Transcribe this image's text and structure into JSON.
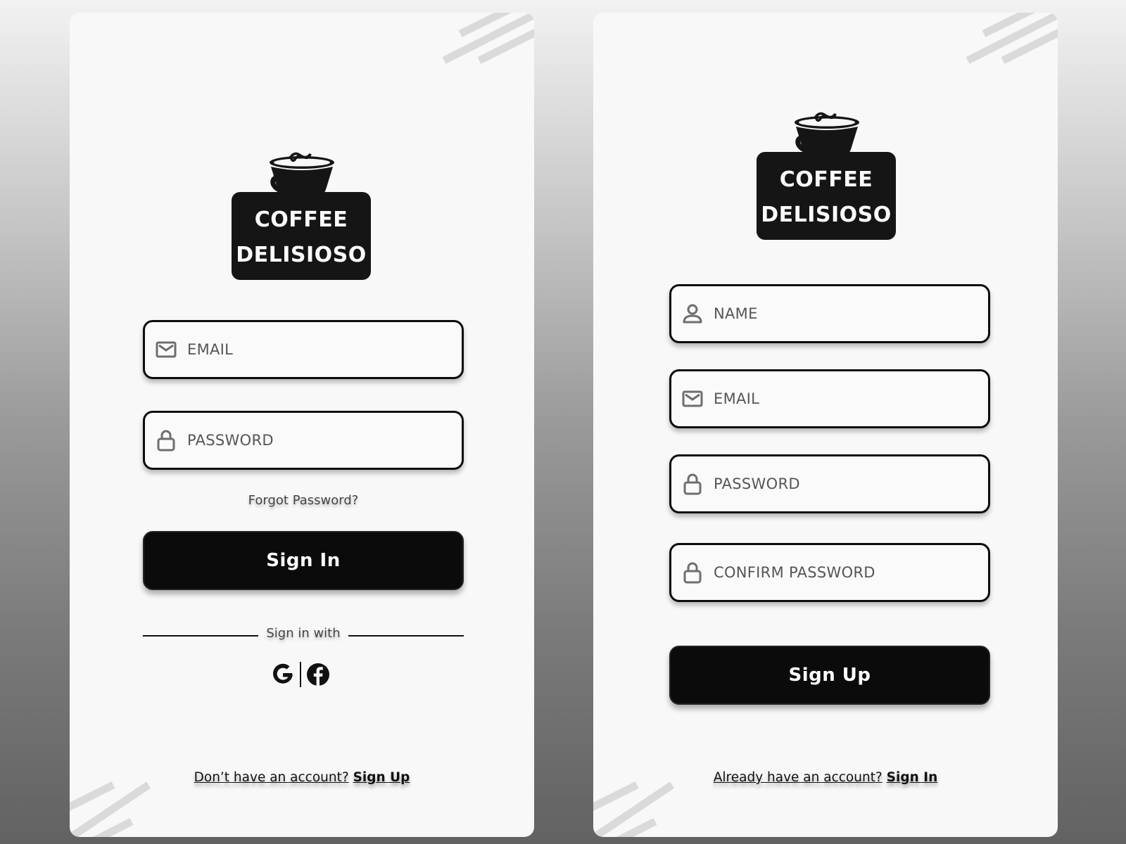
{
  "brand": {
    "line1": "COFFEE",
    "line2": "DELISIOSO",
    "logo_color": "#151515"
  },
  "signin": {
    "fields": [
      {
        "icon": "mail-icon",
        "placeholder": "EMAIL",
        "value": ""
      },
      {
        "icon": "lock-icon",
        "placeholder": "PASSWORD",
        "value": ""
      }
    ],
    "forgot_label": "Forgot Password?",
    "submit_label": "Sign In",
    "divider_label": "Sign in with",
    "social": [
      {
        "icon": "google-icon",
        "label": "Google"
      },
      {
        "icon": "facebook-icon",
        "label": "Facebook"
      }
    ],
    "footer_question": "Don’t have an account?",
    "footer_link": "Sign Up"
  },
  "signup": {
    "fields": [
      {
        "icon": "user-icon",
        "placeholder": "NAME",
        "value": ""
      },
      {
        "icon": "mail-icon",
        "placeholder": "EMAIL",
        "value": ""
      },
      {
        "icon": "lock-icon",
        "placeholder": "PASSWORD",
        "value": ""
      },
      {
        "icon": "lock-icon",
        "placeholder": "CONFIRM PASSWORD",
        "value": ""
      }
    ],
    "submit_label": "Sign Up",
    "footer_question": "Already have an account?",
    "footer_link": "Sign In"
  },
  "colors": {
    "button_bg": "#0b0b0b",
    "panel_bg": "#f8f8f8",
    "placeholder_text": "#555555",
    "icon_gray": "#6e6e6e",
    "decoration": "#dadada"
  }
}
